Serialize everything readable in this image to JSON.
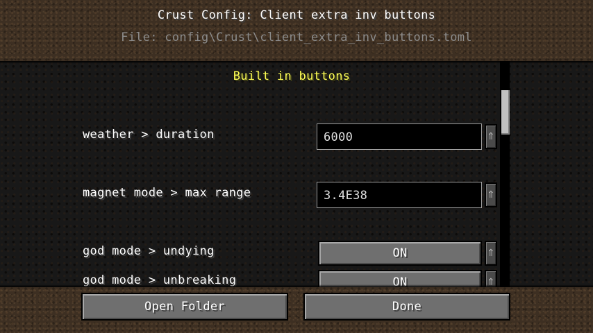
{
  "header": {
    "title": "Crust Config: Client extra inv buttons",
    "file_path": "File: config\\Crust\\client_extra_inv_buttons.toml"
  },
  "section": {
    "title": "Built in buttons"
  },
  "entries": [
    {
      "label": "weather > duration",
      "type": "text",
      "value": "6000"
    },
    {
      "label": "magnet mode > max range",
      "type": "text",
      "value": "3.4E38"
    },
    {
      "label": "god mode > undying",
      "type": "toggle",
      "value": "ON"
    },
    {
      "label": "god mode > unbreaking",
      "type": "toggle",
      "value": "ON"
    }
  ],
  "reset_icon": "reset-arrow-icon",
  "footer": {
    "open_folder_label": "Open Folder",
    "done_label": "Done"
  }
}
